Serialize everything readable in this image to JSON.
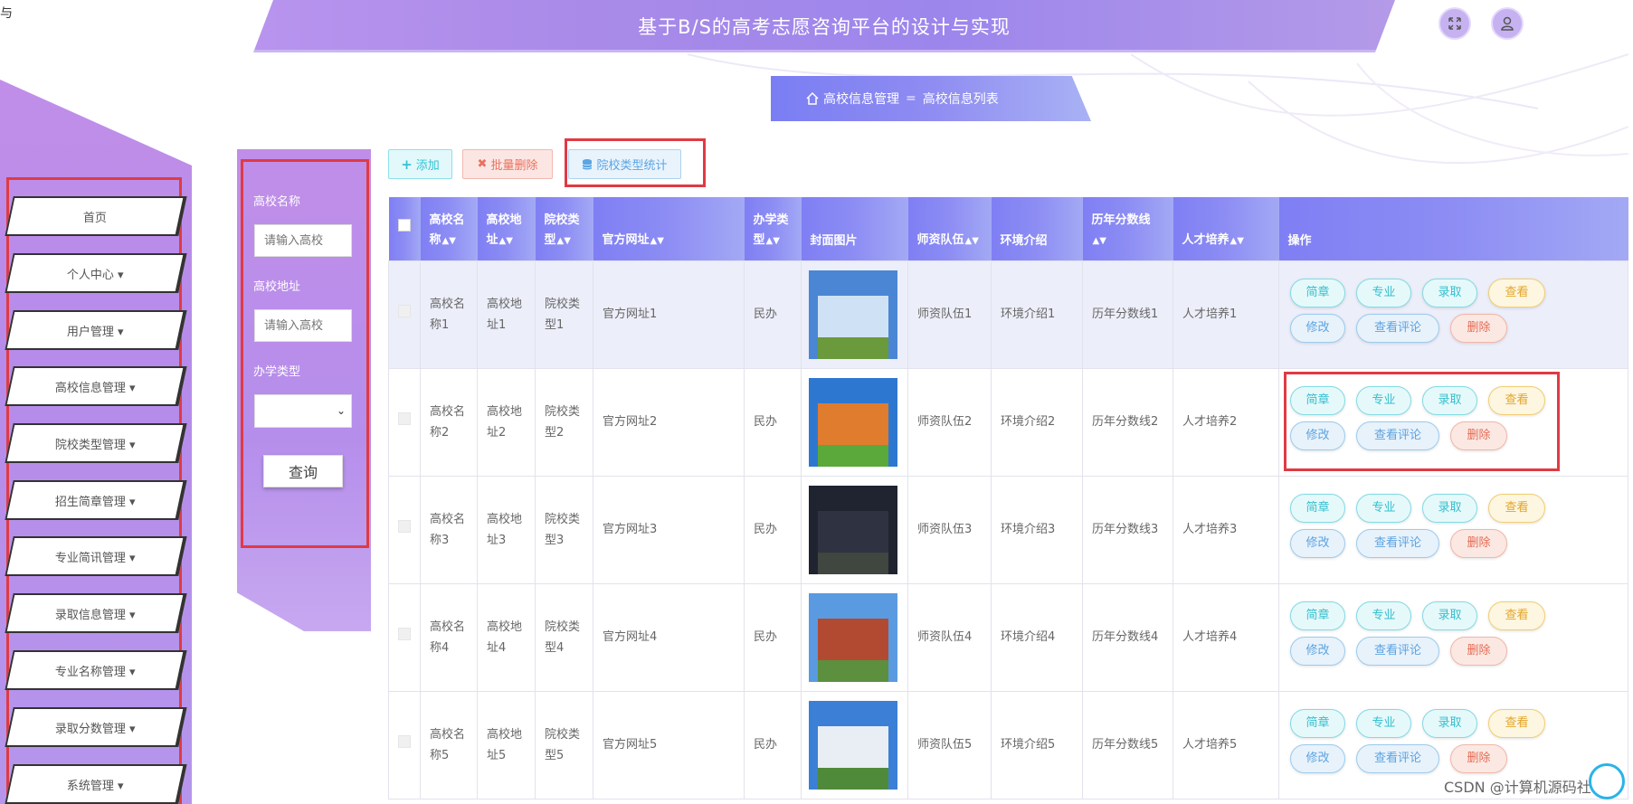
{
  "corner_label": "与",
  "header": {
    "title": "基于B/S的高考志愿咨询平台的设计与实现"
  },
  "icons": {
    "fullscreen": "expand-arrows-icon",
    "user": "user-icon",
    "home": "home-icon"
  },
  "breadcrumb": {
    "home": "高校信息管理",
    "separator": "=",
    "current": "高校信息列表"
  },
  "sidebar": {
    "items": [
      {
        "label": "首页"
      },
      {
        "label": "个人中心 ▾"
      },
      {
        "label": "用户管理 ▾"
      },
      {
        "label": "高校信息管理 ▾"
      },
      {
        "label": "院校类型管理 ▾"
      },
      {
        "label": "招生简章管理 ▾"
      },
      {
        "label": "专业简讯管理 ▾"
      },
      {
        "label": "录取信息管理 ▾"
      },
      {
        "label": "专业名称管理 ▾"
      },
      {
        "label": "录取分数管理 ▾"
      },
      {
        "label": "系统管理 ▾"
      }
    ]
  },
  "search": {
    "name_label": "高校名称",
    "name_placeholder": "请输入高校",
    "address_label": "高校地址",
    "address_placeholder": "请输入高校",
    "type_label": "办学类型",
    "query_label": "查询"
  },
  "toolbar": {
    "add_label": "添加",
    "batch_delete_label": "批量删除",
    "stat_label": "院校类型统计"
  },
  "table": {
    "columns": [
      "高校名称",
      "高校地址",
      "院校类型",
      "官方网址",
      "办学类型",
      "封面图片",
      "师资队伍",
      "环境介绍",
      "历年分数线",
      "人才培养",
      "操作"
    ],
    "rows": [
      {
        "name": "高校名称1",
        "address": "高校地址1",
        "type": "院校类型1",
        "website": "官方网址1",
        "run_type": "民办",
        "faculty": "师资队伍1",
        "environment": "环境介绍1",
        "scores": "历年分数线1",
        "talent": "人才培养1"
      },
      {
        "name": "高校名称2",
        "address": "高校地址2",
        "type": "院校类型2",
        "website": "官方网址2",
        "run_type": "民办",
        "faculty": "师资队伍2",
        "environment": "环境介绍2",
        "scores": "历年分数线2",
        "talent": "人才培养2"
      },
      {
        "name": "高校名称3",
        "address": "高校地址3",
        "type": "院校类型3",
        "website": "官方网址3",
        "run_type": "民办",
        "faculty": "师资队伍3",
        "environment": "环境介绍3",
        "scores": "历年分数线3",
        "talent": "人才培养3"
      },
      {
        "name": "高校名称4",
        "address": "高校地址4",
        "type": "院校类型4",
        "website": "官方网址4",
        "run_type": "民办",
        "faculty": "师资队伍4",
        "environment": "环境介绍4",
        "scores": "历年分数线4",
        "talent": "人才培养4"
      },
      {
        "name": "高校名称5",
        "address": "高校地址5",
        "type": "院校类型5",
        "website": "官方网址5",
        "run_type": "民办",
        "faculty": "师资队伍5",
        "environment": "环境介绍5",
        "scores": "历年分数线5",
        "talent": "人才培养5"
      }
    ],
    "actions": [
      "简章",
      "专业",
      "录取",
      "查看",
      "修改",
      "查看评论",
      "删除"
    ]
  },
  "colors": {
    "header": "#a98ae8",
    "sidebar": "#b68bea",
    "table_header": "#8d8df4",
    "highlight": "#e03a44"
  },
  "watermark": "CSDN @计算机源码社"
}
